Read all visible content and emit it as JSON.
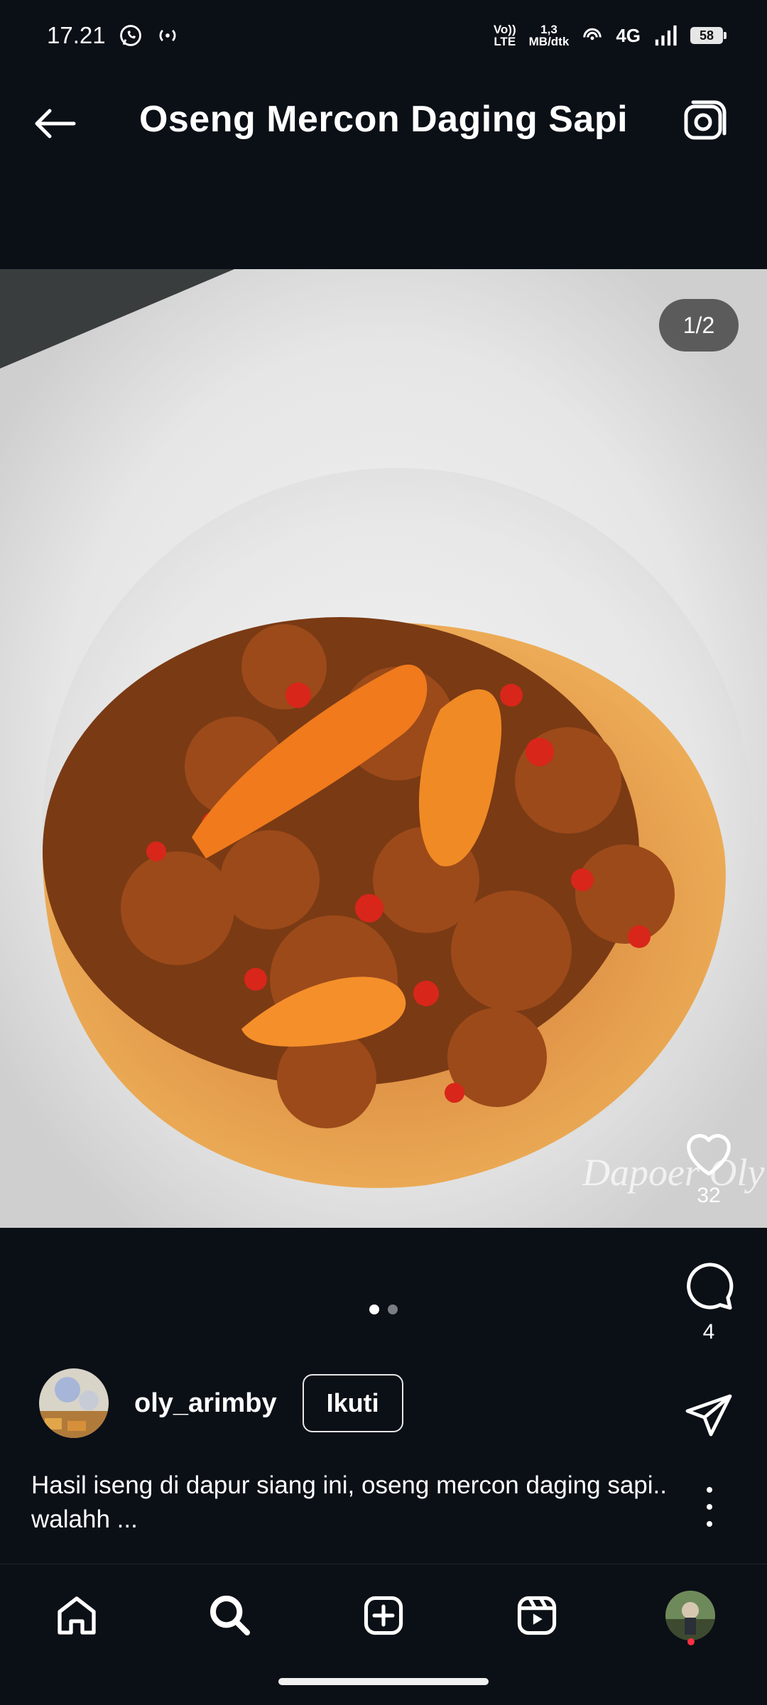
{
  "status_bar": {
    "time": "17.21",
    "volte_top": "Vo))",
    "volte_bottom": "LTE",
    "speed_top": "1,3",
    "speed_bottom": "MB/dtk",
    "network": "4G",
    "battery": "58"
  },
  "header": {
    "title": "Oseng Mercon Daging Sapi"
  },
  "post": {
    "image_counter": "1/2",
    "watermark": "Dapoer Oly",
    "likes": "32",
    "comments": "4",
    "author": "oly_arimby",
    "follow_label": "Ikuti",
    "caption": "Hasil iseng di dapur siang ini, oseng mercon daging sapi.. walahh ..."
  },
  "colors": {
    "background": "#0b0f16",
    "accent_notification": "#ff3040"
  },
  "icons": {
    "back": "arrow-left-icon",
    "camera": "camera-icon",
    "like": "heart-icon",
    "comment": "comment-bubble-icon",
    "share": "paper-plane-icon",
    "more": "more-vertical-icon",
    "nav": [
      "home-icon",
      "search-icon",
      "add-icon",
      "reels-icon",
      "profile-avatar"
    ]
  }
}
